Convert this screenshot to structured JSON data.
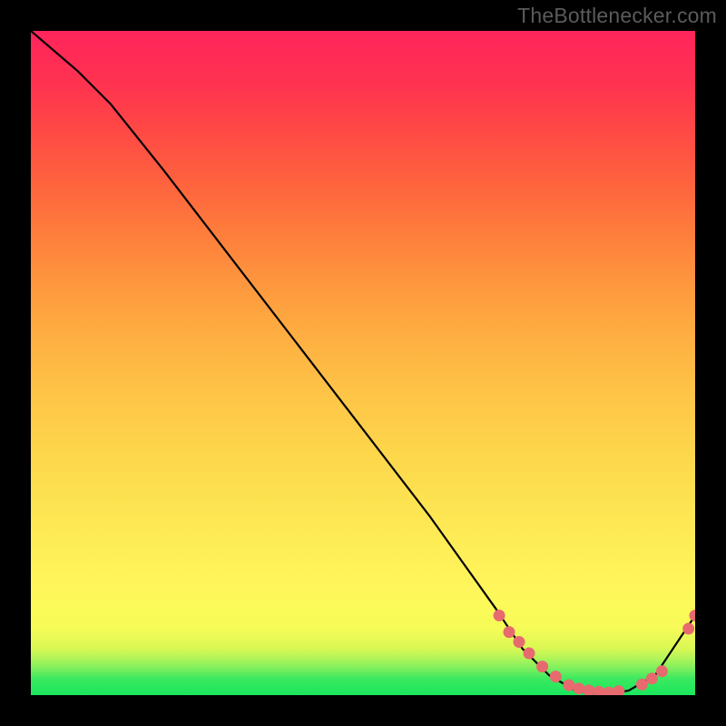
{
  "watermark": "TheBottlenecker.com",
  "chart_data": {
    "type": "line",
    "title": "",
    "xlabel": "",
    "ylabel": "",
    "xlim": [
      0,
      100
    ],
    "ylim": [
      0,
      100
    ],
    "series": [
      {
        "name": "bottleneck-curve",
        "x": [
          0,
          7,
          12,
          20,
          30,
          40,
          50,
          60,
          70,
          74,
          78,
          82,
          86,
          90,
          94,
          100
        ],
        "values": [
          100,
          94,
          89,
          79,
          66,
          53,
          40,
          27,
          13,
          7,
          3,
          0.7,
          0,
          0.7,
          3,
          12
        ]
      }
    ],
    "markers": {
      "name": "highlight-dots",
      "x": [
        70.5,
        72,
        73.5,
        75,
        77,
        79,
        81,
        82.5,
        84,
        85.5,
        87,
        88.5,
        92,
        93.5,
        95,
        99,
        100
      ],
      "values": [
        12,
        9.5,
        8,
        6.3,
        4.3,
        2.8,
        1.5,
        1.0,
        0.7,
        0.5,
        0.4,
        0.6,
        1.6,
        2.5,
        3.6,
        10,
        12
      ]
    },
    "gradient_stops": [
      {
        "pct": 0,
        "color": "#19e65d"
      },
      {
        "pct": 3,
        "color": "#3ce95f"
      },
      {
        "pct": 6,
        "color": "#b0f459"
      },
      {
        "pct": 10,
        "color": "#f5fb57"
      },
      {
        "pct": 18,
        "color": "#fff35a"
      },
      {
        "pct": 30,
        "color": "#fde150"
      },
      {
        "pct": 45,
        "color": "#fec547"
      },
      {
        "pct": 61,
        "color": "#fe9a3e"
      },
      {
        "pct": 77,
        "color": "#fe633e"
      },
      {
        "pct": 92,
        "color": "#ff3350"
      },
      {
        "pct": 100,
        "color": "#ff245b"
      }
    ]
  }
}
